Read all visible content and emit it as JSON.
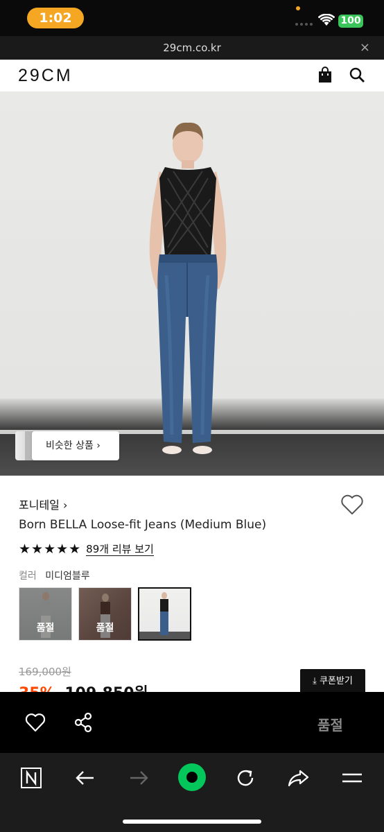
{
  "status_bar": {
    "time": "1:02",
    "battery": "100"
  },
  "browser": {
    "url": "29cm.co.kr",
    "close_symbol": "×"
  },
  "site": {
    "logo": "29CM"
  },
  "hero": {
    "similar_button": "비슷한 상품 ›"
  },
  "product": {
    "brand": "포니테일 ›",
    "title": "Born BELLA Loose-fit Jeans (Medium Blue)",
    "rating_stars": "★★★★★",
    "rating": 5,
    "review_link": "89개 리뷰 보기",
    "color_label": "컬러",
    "color_value": "미디엄블루",
    "swatches": [
      {
        "sold_out_label": "품절"
      },
      {
        "sold_out_label": "품절"
      },
      {
        "sold_out_label": ""
      }
    ],
    "original_price": "169,000원",
    "discount": "35%",
    "sale_price": "109,850원",
    "coupon_button": "⤓ 쿠폰받기"
  },
  "action_bar": {
    "soldout_label": "품절"
  },
  "colors": {
    "accent_orange": "#f5a623",
    "discount_red": "#ff4800",
    "naver_green": "#03c75a",
    "battery_green": "#3ac45a"
  },
  "nav_icons": [
    "naver-n-icon",
    "back-arrow-icon",
    "forward-arrow-icon",
    "green-home-icon",
    "reload-icon",
    "share-arrow-icon",
    "menu-icon"
  ]
}
